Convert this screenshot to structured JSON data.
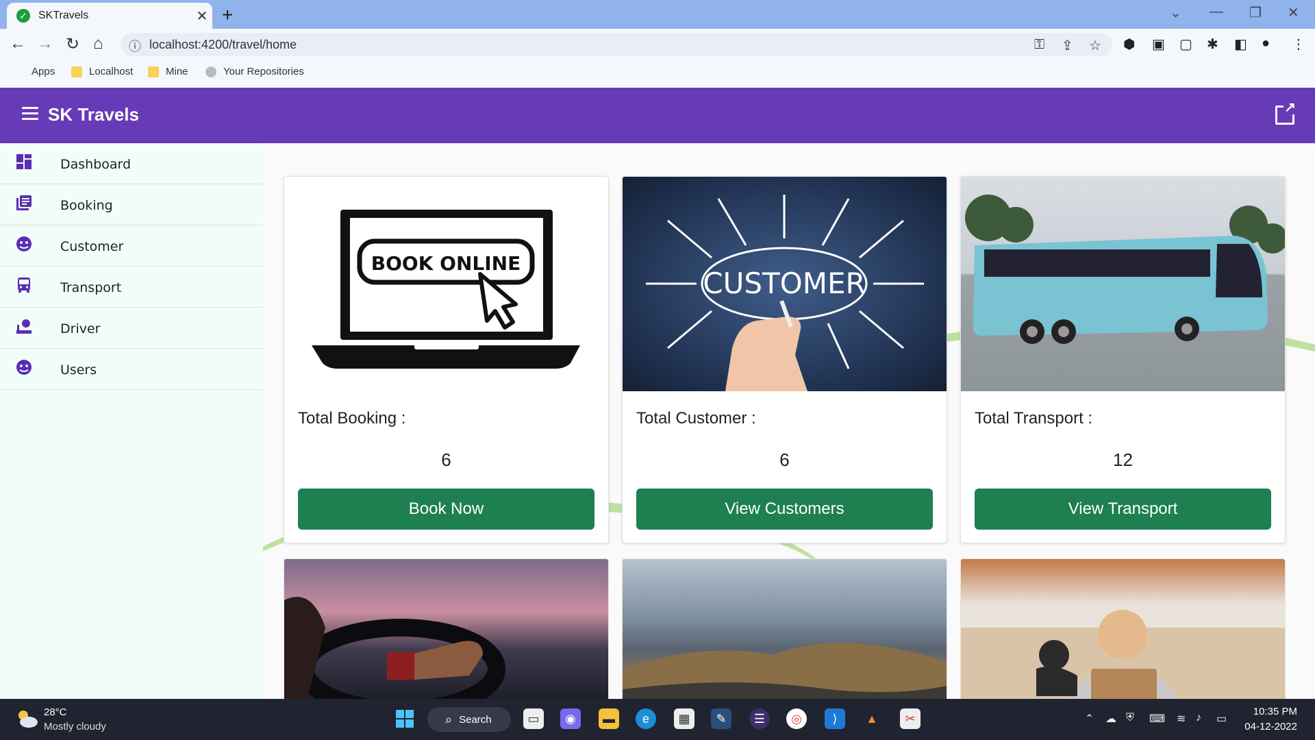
{
  "browser": {
    "tab_title": "SKTravels",
    "url": "localhost:4200/travel/home",
    "bookmarks": [
      {
        "label": "Apps"
      },
      {
        "label": "Localhost"
      },
      {
        "label": "Mine"
      },
      {
        "label": "Your Repositories"
      }
    ]
  },
  "app": {
    "title": "SK Travels",
    "accent_color": "#673ab7"
  },
  "sidebar": {
    "items": [
      {
        "label": "Dashboard",
        "icon": "dashboard-icon"
      },
      {
        "label": "Booking",
        "icon": "library-books-icon"
      },
      {
        "label": "Customer",
        "icon": "face-icon"
      },
      {
        "label": "Transport",
        "icon": "bus-icon"
      },
      {
        "label": "Driver",
        "icon": "driver-icon"
      },
      {
        "label": "Users",
        "icon": "face-icon"
      }
    ]
  },
  "cards": [
    {
      "title": "Total Booking :",
      "value": "6",
      "button": "Book Now",
      "image_text": "BOOK ONLINE"
    },
    {
      "title": "Total Customer :",
      "value": "6",
      "button": "View Customers",
      "image_text": "CUSTOMER"
    },
    {
      "title": "Total Transport :",
      "value": "12",
      "button": "View Transport"
    }
  ],
  "button_color": "#1e8050",
  "taskbar": {
    "temperature": "28°C",
    "weather": "Mostly cloudy",
    "search_label": "Search",
    "time": "10:35 PM",
    "date": "04-12-2022"
  }
}
